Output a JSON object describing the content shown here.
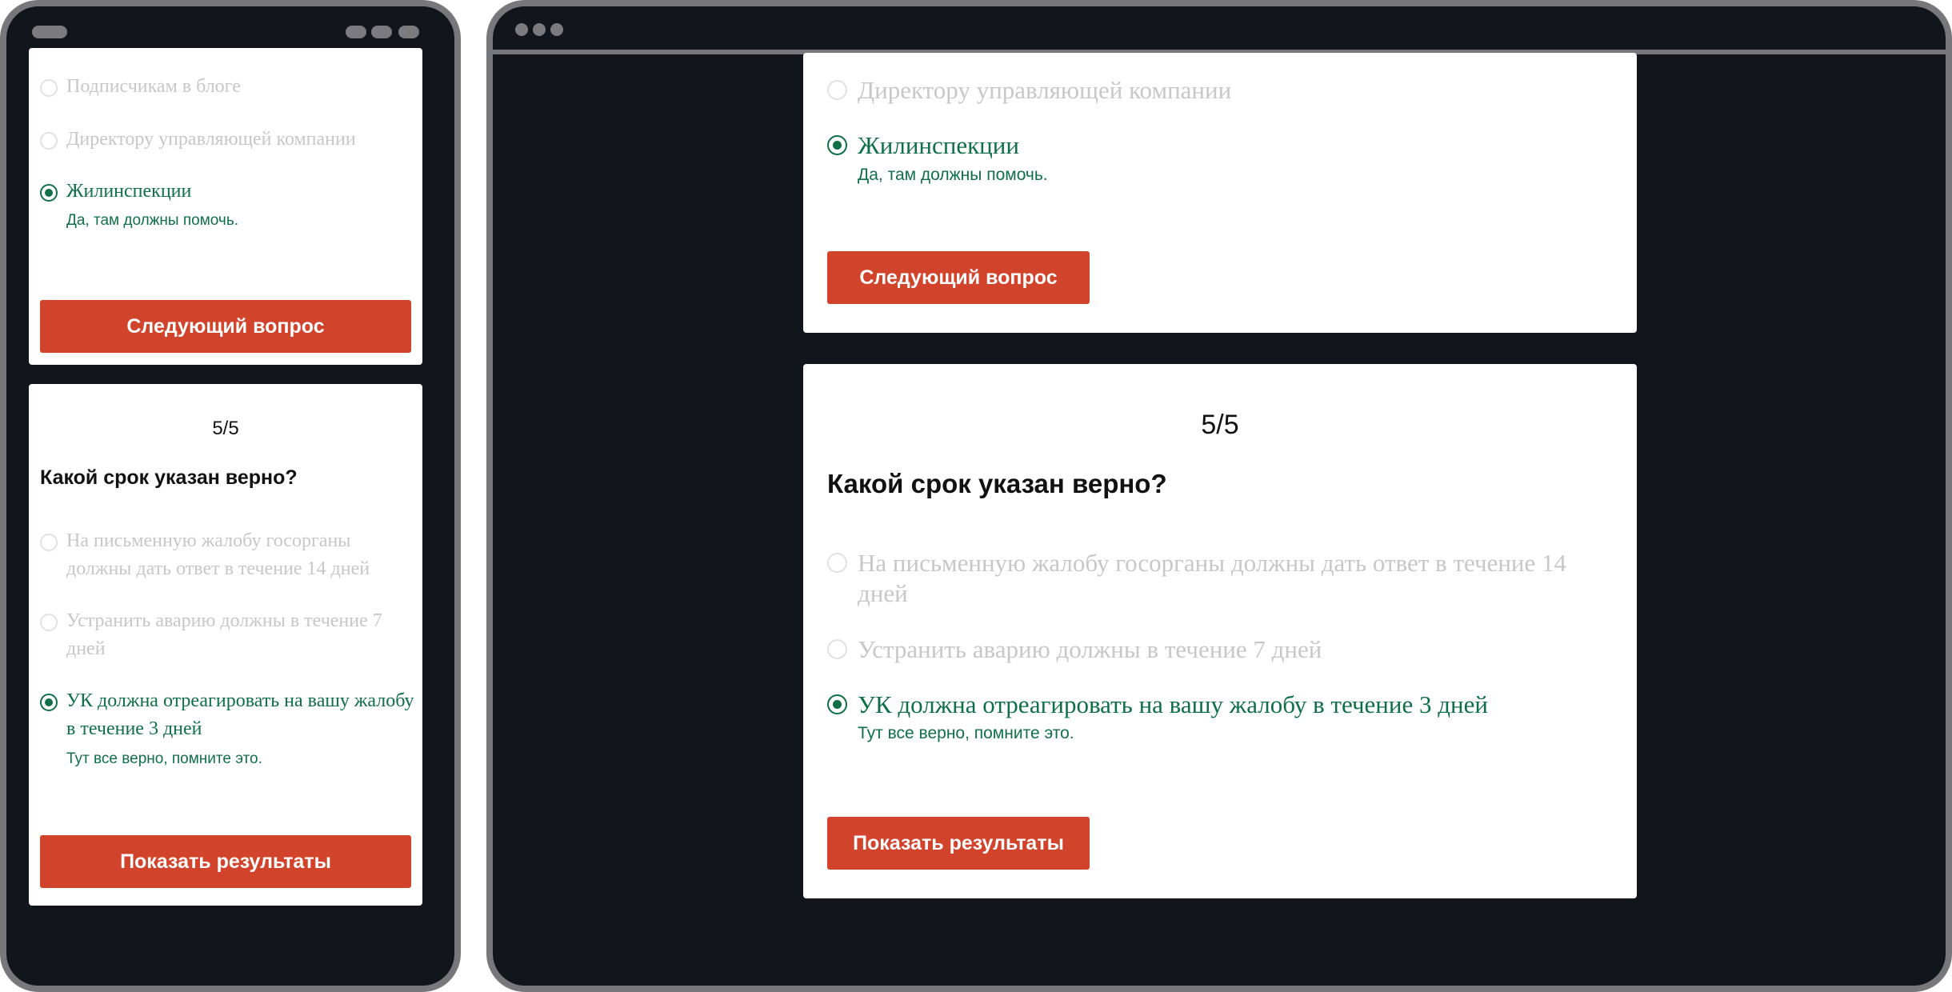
{
  "quiz": {
    "prev_question": {
      "options": [
        {
          "label": "Подписчикам в блоге",
          "selected": false
        },
        {
          "label": "Директору управляющей компании",
          "selected": false
        },
        {
          "label": "Жилинспекции",
          "selected": true
        }
      ],
      "feedback": "Да, там должны помочь.",
      "next_button": "Следующий вопрос"
    },
    "question": {
      "counter": "5/5",
      "title": "Какой срок указан верно?",
      "options": [
        {
          "label": "На письменную жалобу госорганы должны дать ответ в течение 14 дней",
          "selected": false
        },
        {
          "label": "Устранить аварию должны в течение 7 дней",
          "selected": false
        },
        {
          "label": "УК должна отреагировать на вашу жалобу в течение 3 дней",
          "selected": true
        }
      ],
      "feedback": "Тут все верно, помните это.",
      "results_button": "Показать результаты"
    }
  },
  "colors": {
    "accent_green": "#0f7048",
    "button_red": "#d2432c",
    "muted_text": "#c7c7c7",
    "background_dark": "#12151c",
    "frame_gray": "#78787c"
  }
}
